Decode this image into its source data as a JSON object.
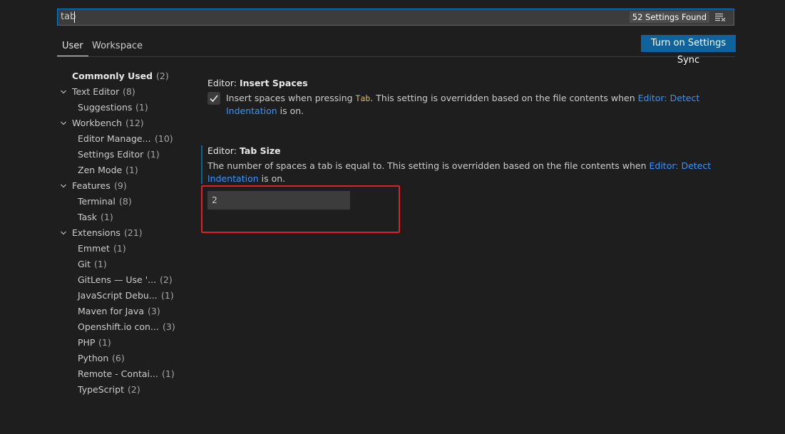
{
  "search": {
    "value": "tab",
    "count_label": "52 Settings Found"
  },
  "tabs": [
    {
      "label": "User",
      "active": true
    },
    {
      "label": "Workspace",
      "active": false
    }
  ],
  "sync_button": {
    "label": "Turn on Settings Sync"
  },
  "toc": [
    {
      "name": "Commonly Used",
      "count": "(2)",
      "level": 0,
      "bold": true,
      "expandable": false
    },
    {
      "name": "Text Editor",
      "count": "(8)",
      "level": 0,
      "bold": false,
      "expandable": true
    },
    {
      "name": "Suggestions",
      "count": "(1)",
      "level": 1
    },
    {
      "name": "Workbench",
      "count": "(12)",
      "level": 0,
      "expandable": true
    },
    {
      "name": "Editor Manage...",
      "count": "(10)",
      "level": 1
    },
    {
      "name": "Settings Editor",
      "count": "(1)",
      "level": 1
    },
    {
      "name": "Zen Mode",
      "count": "(1)",
      "level": 1
    },
    {
      "name": "Features",
      "count": "(9)",
      "level": 0,
      "expandable": true
    },
    {
      "name": "Terminal",
      "count": "(8)",
      "level": 1
    },
    {
      "name": "Task",
      "count": "(1)",
      "level": 1
    },
    {
      "name": "Extensions",
      "count": "(21)",
      "level": 0,
      "expandable": true
    },
    {
      "name": "Emmet",
      "count": "(1)",
      "level": 1
    },
    {
      "name": "Git",
      "count": "(1)",
      "level": 1
    },
    {
      "name": "GitLens — Use '...",
      "count": "(2)",
      "level": 1
    },
    {
      "name": "JavaScript Debu...",
      "count": "(1)",
      "level": 1
    },
    {
      "name": "Maven for Java",
      "count": "(3)",
      "level": 1
    },
    {
      "name": "Openshift.io con...",
      "count": "(3)",
      "level": 1
    },
    {
      "name": "PHP",
      "count": "(1)",
      "level": 1
    },
    {
      "name": "Python",
      "count": "(6)",
      "level": 1
    },
    {
      "name": "Remote - Contai...",
      "count": "(1)",
      "level": 1
    },
    {
      "name": "TypeScript",
      "count": "(2)",
      "level": 1
    }
  ],
  "settings": {
    "insert_spaces": {
      "category": "Editor: ",
      "key": "Insert Spaces",
      "checked": true,
      "desc_pre": "Insert spaces when pressing ",
      "desc_code": "Tab",
      "desc_mid": ". This setting is overridden based on the file contents when ",
      "desc_link": "Editor: Detect Indentation",
      "desc_post": " is on."
    },
    "tab_size": {
      "category": "Editor: ",
      "key": "Tab Size",
      "desc_pre": "The number of spaces a tab is equal to. This setting is overridden based on the file contents when ",
      "desc_link": "Editor: Detect Indentation",
      "desc_post": " is on.",
      "value": "2"
    }
  },
  "colors": {
    "background": "#1e1e1e",
    "accent": "#0e639c",
    "link": "#3794ff",
    "highlight": "#e02020"
  },
  "icons": {
    "filter": "clear-filter-icon",
    "chevron": "chevron-down-icon",
    "check": "check-icon"
  }
}
